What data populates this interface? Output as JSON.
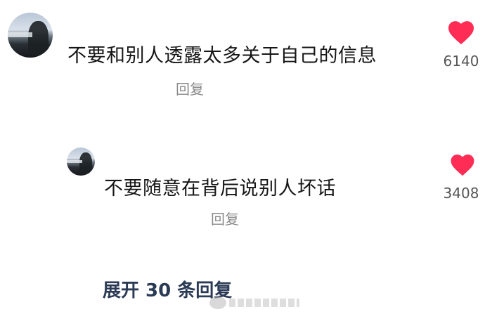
{
  "comments": [
    {
      "text": "不要和别人透露太多关于自己的信息",
      "reply_label": "回复",
      "like_count": "6140",
      "avatar_icon": "user-avatar"
    },
    {
      "text": "不要随意在背后说别人坏话",
      "reply_label": "回复",
      "like_count": "3408",
      "avatar_icon": "user-avatar"
    }
  ],
  "expand_replies_label": "展开 30 条回复",
  "colors": {
    "like_heart": "#ff2d55",
    "reply_text": "#8a8a8a",
    "expand_text": "#2b3a55"
  },
  "icons": {
    "like": "heart-icon"
  }
}
